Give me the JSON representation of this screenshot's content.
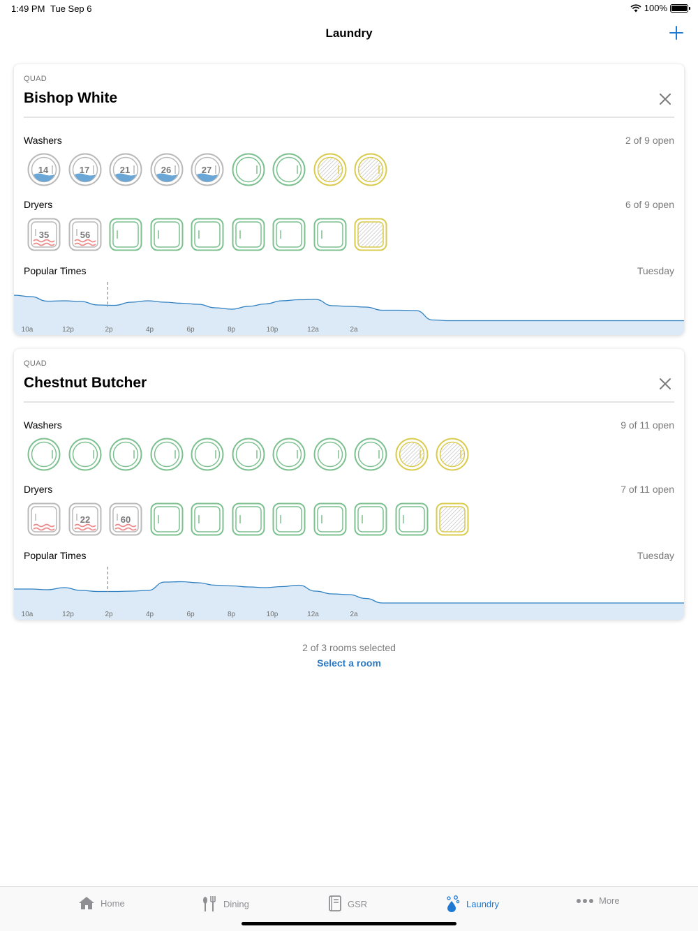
{
  "status": {
    "time": "1:49 PM",
    "date": "Tue Sep 6",
    "battery": "100%"
  },
  "nav": {
    "title": "Laundry"
  },
  "rooms": [
    {
      "kind": "QUAD",
      "name": "Bishop White",
      "washers": {
        "label": "Washers",
        "count": "2 of 9 open",
        "machines": [
          {
            "state": "running",
            "minutes": "14"
          },
          {
            "state": "running",
            "minutes": "17"
          },
          {
            "state": "running",
            "minutes": "21"
          },
          {
            "state": "running",
            "minutes": "26"
          },
          {
            "state": "running",
            "minutes": "27"
          },
          {
            "state": "open",
            "minutes": ""
          },
          {
            "state": "open",
            "minutes": ""
          },
          {
            "state": "broken",
            "minutes": ""
          },
          {
            "state": "broken",
            "minutes": ""
          }
        ]
      },
      "dryers": {
        "label": "Dryers",
        "count": "6 of 9 open",
        "machines": [
          {
            "state": "running",
            "minutes": "35"
          },
          {
            "state": "running",
            "minutes": "56"
          },
          {
            "state": "open",
            "minutes": ""
          },
          {
            "state": "open",
            "minutes": ""
          },
          {
            "state": "open",
            "minutes": ""
          },
          {
            "state": "open",
            "minutes": ""
          },
          {
            "state": "open",
            "minutes": ""
          },
          {
            "state": "open",
            "minutes": ""
          },
          {
            "state": "broken",
            "minutes": ""
          }
        ]
      },
      "popular": {
        "label": "Popular Times",
        "day": "Tuesday",
        "ticks": [
          "10a",
          "12p",
          "2p",
          "4p",
          "6p",
          "8p",
          "10p",
          "12a",
          "2a"
        ],
        "levels": [
          0.78,
          0.74,
          0.61,
          0.62,
          0.6,
          0.5,
          0.49,
          0.58,
          0.62,
          0.58,
          0.55,
          0.52,
          0.42,
          0.38,
          0.46,
          0.53,
          0.62,
          0.65,
          0.66,
          0.48,
          0.46,
          0.44,
          0.35,
          0.35,
          0.34,
          0.07,
          0.05,
          0.05,
          0.05,
          0.05,
          0.05,
          0.05,
          0.05,
          0.05,
          0.05,
          0.05,
          0.05,
          0.05,
          0.05,
          0.05,
          0.05
        ],
        "now_index": 6
      }
    },
    {
      "kind": "QUAD",
      "name": "Chestnut Butcher",
      "washers": {
        "label": "Washers",
        "count": "9 of 11 open",
        "machines": [
          {
            "state": "open",
            "minutes": ""
          },
          {
            "state": "open",
            "minutes": ""
          },
          {
            "state": "open",
            "minutes": ""
          },
          {
            "state": "open",
            "minutes": ""
          },
          {
            "state": "open",
            "minutes": ""
          },
          {
            "state": "open",
            "minutes": ""
          },
          {
            "state": "open",
            "minutes": ""
          },
          {
            "state": "open",
            "minutes": ""
          },
          {
            "state": "open",
            "minutes": ""
          },
          {
            "state": "broken",
            "minutes": ""
          },
          {
            "state": "broken",
            "minutes": ""
          }
        ]
      },
      "dryers": {
        "label": "Dryers",
        "count": "7 of 11 open",
        "machines": [
          {
            "state": "running",
            "minutes": ""
          },
          {
            "state": "running",
            "minutes": "22"
          },
          {
            "state": "running",
            "minutes": "60"
          },
          {
            "state": "open",
            "minutes": ""
          },
          {
            "state": "open",
            "minutes": ""
          },
          {
            "state": "open",
            "minutes": ""
          },
          {
            "state": "open",
            "minutes": ""
          },
          {
            "state": "open",
            "minutes": ""
          },
          {
            "state": "open",
            "minutes": ""
          },
          {
            "state": "open",
            "minutes": ""
          },
          {
            "state": "broken",
            "minutes": ""
          }
        ]
      },
      "popular": {
        "label": "Popular Times",
        "day": "Tuesday",
        "ticks": [
          "10a",
          "12p",
          "2p",
          "4p",
          "6p",
          "8p",
          "10p",
          "12a",
          "2a"
        ],
        "levels": [
          0.52,
          0.52,
          0.5,
          0.56,
          0.48,
          0.45,
          0.45,
          0.46,
          0.48,
          0.72,
          0.73,
          0.7,
          0.63,
          0.61,
          0.58,
          0.56,
          0.59,
          0.63,
          0.46,
          0.38,
          0.36,
          0.25,
          0.12,
          0.12,
          0.12,
          0.12,
          0.12,
          0.12,
          0.12,
          0.12,
          0.12,
          0.12,
          0.12,
          0.12,
          0.12,
          0.12,
          0.12,
          0.12,
          0.12,
          0.12,
          0.12
        ],
        "now_index": 6
      }
    }
  ],
  "footer": {
    "selected": "2 of 3 rooms selected",
    "link": "Select a room"
  },
  "tabs": [
    {
      "label": "Home",
      "icon": "home-icon",
      "active": false
    },
    {
      "label": "Dining",
      "icon": "dining-icon",
      "active": false
    },
    {
      "label": "GSR",
      "icon": "book-icon",
      "active": false
    },
    {
      "label": "Laundry",
      "icon": "laundry-icon",
      "active": true
    },
    {
      "label": "More",
      "icon": "more-icon",
      "active": false
    }
  ],
  "colors": {
    "open": "#7cc08f",
    "running": "#b9b9b9",
    "broken": "#d9cb4d",
    "water": "#6aa6d6",
    "heat": "#ec8a8a",
    "accent": "#1f78d1",
    "chart_line": "#2d7fc1",
    "chart_fill": "#dbeaf6"
  }
}
